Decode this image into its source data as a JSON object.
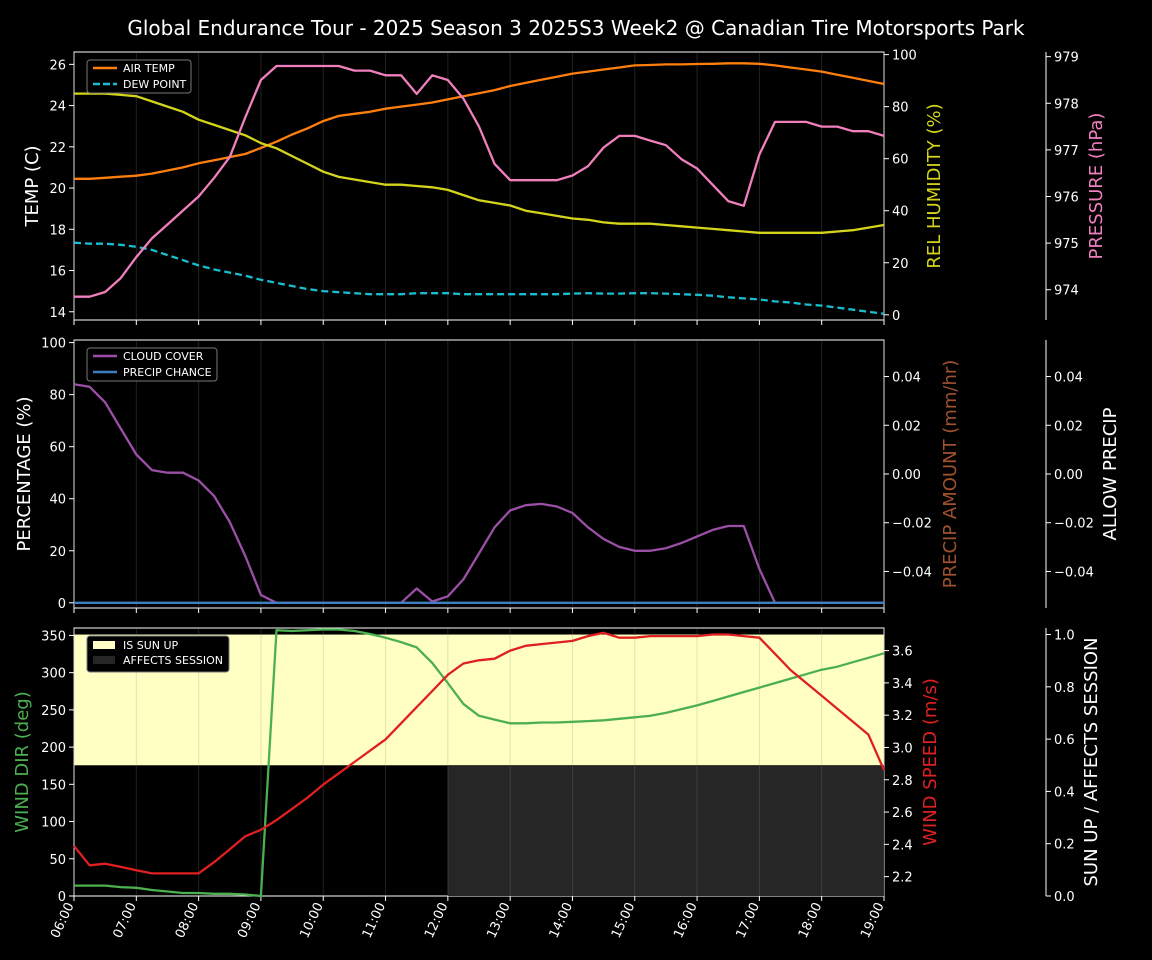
{
  "title": "Global Endurance Tour - 2025 Season 3 2025S3 Week2 @ Canadian Tire Motorsports Park",
  "colors": {
    "background": "#000000",
    "axis": "#ffffff",
    "air_temp": "#ff7f0e",
    "dew_point": "#17becf",
    "humidity": "#d4d41c",
    "pressure": "#f07fbd",
    "cloud_cover": "#9b4fa6",
    "precip_chance": "#3f7fbf",
    "precip_amount_label": "#a0522d",
    "wind_dir": "#4caf50",
    "wind_speed": "#e02020",
    "sun_up": "#ffffc4",
    "affects_session": "#262626"
  },
  "x_ticks": [
    "06:00",
    "07:00",
    "08:00",
    "09:00",
    "10:00",
    "11:00",
    "12:00",
    "13:00",
    "14:00",
    "15:00",
    "16:00",
    "17:00",
    "18:00",
    "19:00"
  ],
  "chart_data": [
    {
      "type": "line",
      "panel": "temperature",
      "xlabel": "",
      "x_range": [
        6,
        19
      ],
      "ylabel": "TEMP (C)",
      "ylim": [
        13.6,
        26.6
      ],
      "y_ticks": [
        "14",
        "16",
        "18",
        "20",
        "22",
        "24",
        "26"
      ],
      "y2label": "REL HUMIDITY (%)",
      "y2lim": [
        -2,
        101
      ],
      "y2_ticks": [
        "0",
        "20",
        "40",
        "60",
        "80",
        "100"
      ],
      "y3label": "PRESSURE (hPa)",
      "y3lim": [
        973.35,
        979.1
      ],
      "y3_ticks": [
        "974",
        "975",
        "976",
        "977",
        "978",
        "979"
      ],
      "legend_position": "upper-left",
      "legend": [
        "AIR TEMP",
        "DEW POINT"
      ],
      "x": [
        6,
        6.25,
        6.5,
        6.75,
        7,
        7.25,
        7.5,
        7.75,
        8,
        8.25,
        8.5,
        8.75,
        9,
        9.25,
        9.5,
        9.75,
        10,
        10.25,
        10.5,
        10.75,
        11,
        11.25,
        11.5,
        11.75,
        12,
        12.25,
        12.5,
        12.75,
        13,
        13.25,
        13.5,
        13.75,
        14,
        14.25,
        14.5,
        14.75,
        15,
        15.25,
        15.5,
        15.75,
        16,
        16.25,
        16.5,
        16.75,
        17,
        17.25,
        17.5,
        17.75,
        18,
        18.25,
        18.5,
        18.75,
        19
      ],
      "series": [
        {
          "name": "AIR TEMP",
          "axis": "left",
          "values": [
            20.45,
            20.45,
            20.5,
            20.55,
            20.6,
            20.7,
            20.85,
            21.0,
            21.2,
            21.35,
            21.5,
            21.65,
            21.95,
            22.25,
            22.6,
            22.9,
            23.25,
            23.5,
            23.6,
            23.7,
            23.85,
            23.95,
            24.05,
            24.15,
            24.3,
            24.45,
            24.6,
            24.75,
            24.95,
            25.1,
            25.25,
            25.4,
            25.55,
            25.65,
            25.75,
            25.85,
            25.95,
            25.97,
            26.0,
            26.0,
            26.02,
            26.03,
            26.05,
            26.05,
            26.03,
            25.95,
            25.85,
            25.75,
            25.65,
            25.5,
            25.35,
            25.2,
            25.05
          ]
        },
        {
          "name": "DEW POINT",
          "axis": "left",
          "values": [
            17.35,
            17.3,
            17.3,
            17.25,
            17.15,
            17.0,
            16.75,
            16.5,
            16.25,
            16.05,
            15.9,
            15.75,
            15.55,
            15.4,
            15.25,
            15.1,
            15.0,
            14.95,
            14.9,
            14.85,
            14.85,
            14.85,
            14.9,
            14.9,
            14.9,
            14.85,
            14.85,
            14.85,
            14.85,
            14.85,
            14.85,
            14.85,
            14.88,
            14.9,
            14.88,
            14.88,
            14.9,
            14.9,
            14.88,
            14.85,
            14.82,
            14.78,
            14.7,
            14.65,
            14.6,
            14.5,
            14.45,
            14.35,
            14.3,
            14.2,
            14.1,
            14.0,
            13.9
          ]
        },
        {
          "name": "REL HUMIDITY",
          "axis": "right",
          "values": [
            85,
            85,
            85,
            84.5,
            84,
            82,
            80,
            78,
            75,
            73,
            71,
            69,
            66,
            64,
            61,
            58,
            55,
            53,
            52,
            51,
            50,
            50,
            49.5,
            49,
            48,
            46,
            44,
            43,
            42,
            40,
            39,
            38,
            37,
            36.5,
            35.5,
            35,
            35,
            35,
            34.5,
            34,
            33.5,
            33,
            32.5,
            32,
            31.5,
            31.5,
            31.5,
            31.5,
            31.5,
            32,
            32.5,
            33.5,
            34.5
          ]
        },
        {
          "name": "PRESSURE",
          "axis": "right2",
          "values": [
            973.85,
            973.85,
            973.95,
            974.25,
            974.7,
            975.1,
            975.4,
            975.7,
            976.0,
            976.4,
            976.85,
            977.7,
            978.5,
            978.8,
            978.8,
            978.8,
            978.8,
            978.8,
            978.7,
            978.7,
            978.6,
            978.6,
            978.2,
            978.6,
            978.5,
            978.1,
            977.5,
            976.7,
            976.35,
            976.35,
            976.35,
            976.35,
            976.45,
            976.65,
            977.05,
            977.3,
            977.3,
            977.2,
            977.1,
            976.8,
            976.6,
            976.25,
            975.9,
            975.8,
            976.9,
            977.6,
            977.6,
            977.6,
            977.5,
            977.5,
            977.4,
            977.4,
            977.3
          ]
        }
      ]
    },
    {
      "type": "line",
      "panel": "precipitation",
      "xlabel": "",
      "x_range": [
        6,
        19
      ],
      "ylabel": "PERCENTAGE (%)",
      "ylim": [
        -2,
        101
      ],
      "y_ticks": [
        "0",
        "20",
        "40",
        "60",
        "80",
        "100"
      ],
      "y2label": "PRECIP AMOUNT (mm/hr)",
      "y2lim": [
        -0.055,
        0.055
      ],
      "y2_ticks": [
        "−0.04",
        "−0.02",
        "0.00",
        "0.02",
        "0.04"
      ],
      "y3label": "ALLOW PRECIP",
      "y3lim": [
        -0.055,
        0.055
      ],
      "y3_ticks": [
        "−0.04",
        "−0.02",
        "0.00",
        "0.02",
        "0.04"
      ],
      "legend_position": "upper-left",
      "legend": [
        "CLOUD COVER",
        "PRECIP CHANCE"
      ],
      "x": [
        6,
        6.25,
        6.5,
        6.75,
        7,
        7.25,
        7.5,
        7.75,
        8,
        8.25,
        8.5,
        8.75,
        9,
        9.25,
        9.5,
        9.75,
        10,
        10.25,
        10.5,
        10.75,
        11,
        11.25,
        11.5,
        11.75,
        12,
        12.25,
        12.5,
        12.75,
        13,
        13.25,
        13.5,
        13.75,
        14,
        14.25,
        14.5,
        14.75,
        15,
        15.25,
        15.5,
        15.75,
        16,
        16.25,
        16.5,
        16.75,
        17,
        17.25,
        17.5,
        17.75,
        18,
        18.25,
        18.5,
        18.75,
        19
      ],
      "series": [
        {
          "name": "CLOUD COVER",
          "axis": "left",
          "values": [
            84,
            83,
            77,
            67,
            57,
            51,
            50,
            50,
            47,
            41,
            31,
            18,
            3,
            0,
            0,
            0,
            0,
            0,
            0,
            0,
            0,
            0,
            5.5,
            0.5,
            2.5,
            9,
            19,
            29,
            35.5,
            37.5,
            38,
            37,
            34.5,
            29,
            24.5,
            21.5,
            20,
            20,
            21,
            23,
            25.5,
            28,
            29.5,
            29.5,
            13,
            0,
            0,
            0,
            0,
            0,
            0,
            0,
            0
          ]
        },
        {
          "name": "PRECIP CHANCE",
          "axis": "left",
          "values": [
            0,
            0,
            0,
            0,
            0,
            0,
            0,
            0,
            0,
            0,
            0,
            0,
            0,
            0,
            0,
            0,
            0,
            0,
            0,
            0,
            0,
            0,
            0,
            0,
            0,
            0,
            0,
            0,
            0,
            0,
            0,
            0,
            0,
            0,
            0,
            0,
            0,
            0,
            0,
            0,
            0,
            0,
            0,
            0,
            0,
            0,
            0,
            0,
            0,
            0,
            0,
            0,
            0
          ]
        }
      ]
    },
    {
      "type": "line",
      "panel": "wind",
      "xlabel": "",
      "x_range": [
        6,
        19
      ],
      "ylabel": "WIND DIR (deg)",
      "ylim": [
        0,
        360
      ],
      "y_ticks": [
        "0",
        "50",
        "100",
        "150",
        "200",
        "250",
        "300",
        "350"
      ],
      "y2label": "WIND SPEED (m/s)",
      "y2lim": [
        2.08,
        3.74
      ],
      "y2_ticks": [
        "2.2",
        "2.4",
        "2.6",
        "2.8",
        "3.0",
        "3.2",
        "3.4",
        "3.6"
      ],
      "y3label": "SUN UP / AFFECTS SESSION",
      "y3lim": [
        0,
        1.025
      ],
      "y3_ticks": [
        "0.0",
        "0.2",
        "0.4",
        "0.6",
        "0.8",
        "1.0"
      ],
      "legend_position": "upper-left",
      "legend": [
        "IS SUN UP",
        "AFFECTS SESSION"
      ],
      "sun_up": [
        {
          "start": 6,
          "end": 19,
          "value": 1
        }
      ],
      "sun_up_floor": 0.5,
      "affects_session": [
        {
          "start": 12,
          "end": 19,
          "value": 0.5
        }
      ],
      "x": [
        6,
        6.25,
        6.5,
        6.75,
        7,
        7.25,
        7.5,
        7.75,
        8,
        8.25,
        8.5,
        8.75,
        9,
        9.25,
        9.5,
        9.75,
        10,
        10.25,
        10.5,
        10.75,
        11,
        11.25,
        11.5,
        11.75,
        12,
        12.25,
        12.5,
        12.75,
        13,
        13.25,
        13.5,
        13.75,
        14,
        14.25,
        14.5,
        14.75,
        15,
        15.25,
        15.5,
        15.75,
        16,
        16.25,
        16.5,
        16.75,
        17,
        17.25,
        17.5,
        17.75,
        18,
        18.25,
        18.5,
        18.75,
        19
      ],
      "series": [
        {
          "name": "WIND DIR",
          "axis": "left",
          "values": [
            14,
            14,
            14,
            12,
            11,
            8,
            6,
            4,
            4,
            3,
            3,
            2,
            0,
            357,
            356,
            357,
            358,
            358,
            356,
            352,
            347,
            341,
            334,
            313,
            286,
            258,
            242,
            237,
            232,
            232,
            233,
            233,
            234,
            235,
            236,
            238,
            240,
            242,
            246,
            251,
            256,
            262,
            268,
            274,
            280,
            286,
            292,
            298,
            304,
            308,
            314,
            320,
            326
          ]
        },
        {
          "name": "WIND SPEED",
          "axis": "right",
          "values": [
            2.39,
            2.27,
            2.28,
            2.26,
            2.24,
            2.22,
            2.22,
            2.22,
            2.22,
            2.29,
            2.37,
            2.45,
            2.49,
            2.55,
            2.62,
            2.69,
            2.77,
            2.84,
            2.91,
            2.98,
            3.05,
            3.15,
            3.25,
            3.35,
            3.45,
            3.52,
            3.54,
            3.55,
            3.6,
            3.63,
            3.64,
            3.65,
            3.66,
            3.69,
            3.71,
            3.68,
            3.68,
            3.69,
            3.69,
            3.69,
            3.69,
            3.7,
            3.7,
            3.69,
            3.68,
            3.58,
            3.48,
            3.4,
            3.32,
            3.24,
            3.16,
            3.08,
            2.86
          ]
        }
      ]
    }
  ]
}
